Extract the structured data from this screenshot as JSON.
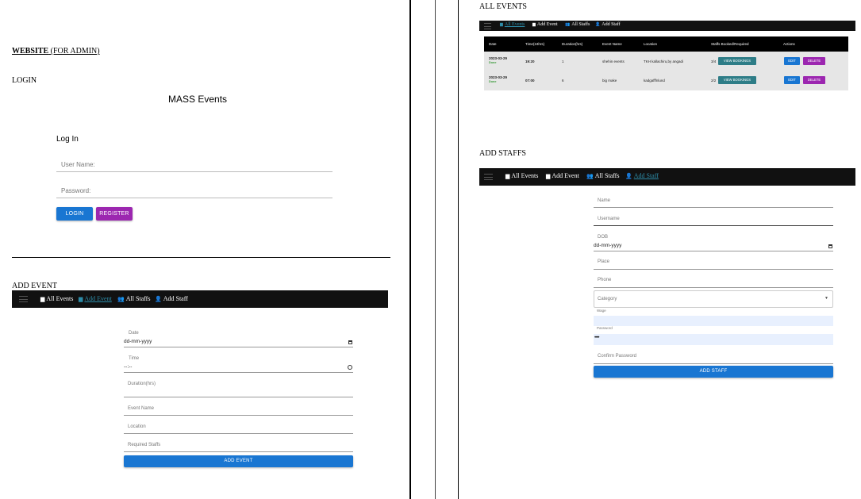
{
  "left": {
    "website_heading": "WEBSITE",
    "website_suffix": " (FOR ADMIN)",
    "login_heading": "LOGIN",
    "app_title": "MASS Events",
    "login_title": "Log In",
    "username_placeholder": "User Name:",
    "password_placeholder": "Password:",
    "login_button": "LOGIN",
    "register_button": "REGISTER",
    "add_event_heading": "ADD EVENT",
    "nav": {
      "all_events": "All Events",
      "add_event": "Add Event",
      "all_staffs": "All Staffs",
      "add_staff": "Add Staff"
    },
    "form": {
      "date_label": "Date",
      "date_value": "dd-mm-yyyy",
      "time_label": "Time",
      "time_value": "--:--",
      "duration_label": "Duration(hrs)",
      "event_name_label": "Event Name",
      "location_label": "Location",
      "required_staffs_label": "Required Staffs",
      "submit": "ADD EVENT"
    }
  },
  "right": {
    "all_events_heading": "ALL EVENTS",
    "nav": {
      "all_events": "All Events",
      "add_event": "Add Event",
      "all_staffs": "All Staffs",
      "add_staff": "Add Staff"
    },
    "table": {
      "headers": [
        "Date",
        "Time(24hrs)",
        "Duration(hrs)",
        "Event Name",
        "Location",
        "Staffs Booked/Required",
        "Actions"
      ],
      "rows": [
        {
          "date": "2023-03-29",
          "status": "Done",
          "time": "19:20",
          "duration": "1",
          "event": "shehin events",
          "location": "TKH kallachiru,by angadi",
          "booked": "3/4",
          "view": "VIEW BOOKINGS",
          "edit": "EDIT",
          "delete": "DELETE"
        },
        {
          "date": "2023-03-29",
          "status": "Done",
          "time": "07:00",
          "duration": "6",
          "event": "big make",
          "location": "kadgafffnlund",
          "booked": "2/2",
          "view": "VIEW BOOKINGS",
          "edit": "EDIT",
          "delete": "DELETE"
        }
      ]
    },
    "add_staffs_heading": "ADD STAFFS",
    "nav2": {
      "all_events": "All Events",
      "add_event": "Add Event",
      "all_staffs": "All Staffs",
      "add_staff": "Add Staff"
    },
    "form": {
      "name": "Name",
      "username": "Username",
      "dob_label": "DOB",
      "dob_value": "dd-mm-yyyy",
      "place": "Place",
      "phone": "Phone",
      "category": "Category",
      "wage": "Wage",
      "password_label": "Password",
      "password_value": "•••••",
      "confirm_password": "Confirm Password",
      "submit": "ADD STAFF"
    }
  },
  "colors": {
    "primary": "#1976d2",
    "secondary": "#9c27b0",
    "teal": "#2e7d87",
    "nav_bg": "#111111",
    "active_link": "#2d8ca8"
  }
}
